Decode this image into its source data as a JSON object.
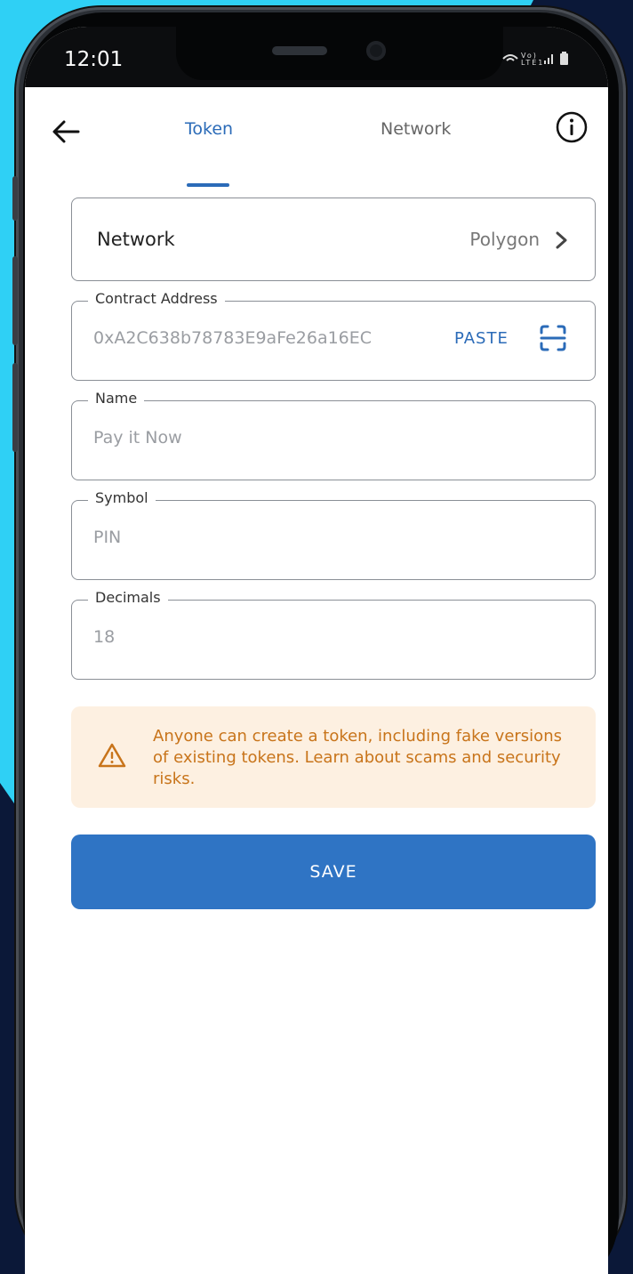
{
  "status": {
    "time": "12:01",
    "icons": "wifi, volte, lte, signal, battery"
  },
  "header": {
    "tabs": [
      {
        "label": "Token",
        "active": true
      },
      {
        "label": "Network",
        "active": false
      }
    ],
    "back_icon": "back-arrow-icon",
    "info_icon": "info-icon"
  },
  "network_row": {
    "label": "Network",
    "value": "Polygon"
  },
  "fields": {
    "contract": {
      "legend": "Contract Address",
      "value": "0xA2C638b78783E9aFe26a16EC",
      "paste_label": "PASTE"
    },
    "name": {
      "legend": "Name",
      "value": "Pay it Now"
    },
    "symbol": {
      "legend": "Symbol",
      "value": "PIN"
    },
    "decimals": {
      "legend": "Decimals",
      "value": "18"
    }
  },
  "warning": {
    "text": "Anyone can create a token, including fake versions of existing tokens. Learn about scams and security risks."
  },
  "actions": {
    "save_label": "SAVE"
  },
  "colors": {
    "accent": "#2b6bb8",
    "button": "#2f74c4",
    "warning_bg": "#fdf0e1",
    "warning_text": "#c8741a",
    "page_bg": "#0b1838",
    "cyan_shape": "#2fd0f5"
  }
}
